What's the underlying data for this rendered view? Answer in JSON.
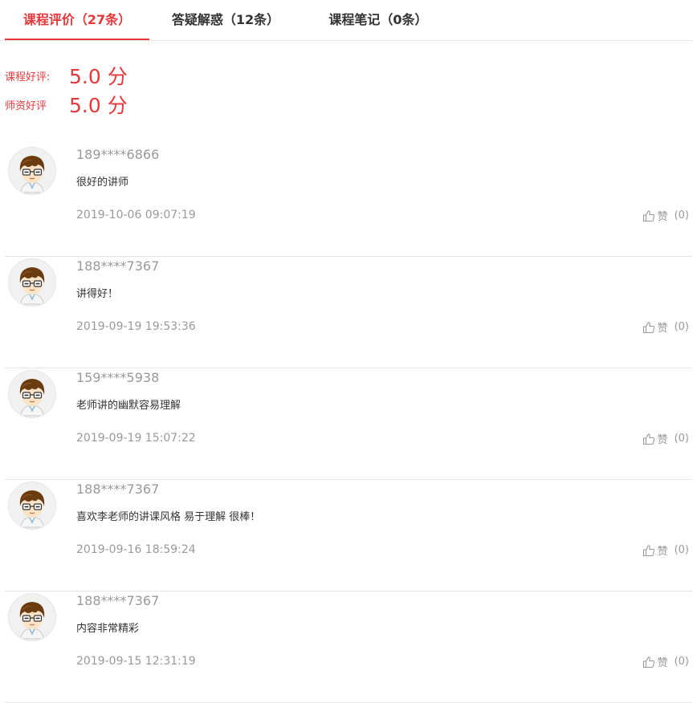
{
  "tabs": [
    {
      "label": "课程评价（27条）",
      "active": true
    },
    {
      "label": "答疑解惑（12条）",
      "active": false
    },
    {
      "label": "课程笔记（0条）",
      "active": false
    }
  ],
  "ratings": [
    {
      "label": "课程好评:",
      "score": "5.0 分"
    },
    {
      "label": "师资好评",
      "score": "5.0 分"
    }
  ],
  "like_label": "赞",
  "reviews": [
    {
      "user": "189****6866",
      "comment": "很好的讲师",
      "time": "2019-10-06 09:07:19",
      "likes": "(0)"
    },
    {
      "user": "188****7367",
      "comment": "讲得好！",
      "time": "2019-09-19 19:53:36",
      "likes": "(0)"
    },
    {
      "user": "159****5938",
      "comment": "老师讲的幽默容易理解",
      "time": "2019-09-19 15:07:22",
      "likes": "(0)"
    },
    {
      "user": "188****7367",
      "comment": "喜欢李老师的讲课风格 易于理解 很棒！",
      "time": "2019-09-16 18:59:24",
      "likes": "(0)"
    },
    {
      "user": "188****7367",
      "comment": "内容非常精彩",
      "time": "2019-09-15 12:31:19",
      "likes": "(0)"
    }
  ],
  "colors": {
    "accent": "#e5383b",
    "muted": "#999999",
    "text": "#333333",
    "divider": "#e5e5e5"
  },
  "icons": {
    "avatar": "cartoon-avatar-icon",
    "like": "thumbs-up-icon"
  }
}
